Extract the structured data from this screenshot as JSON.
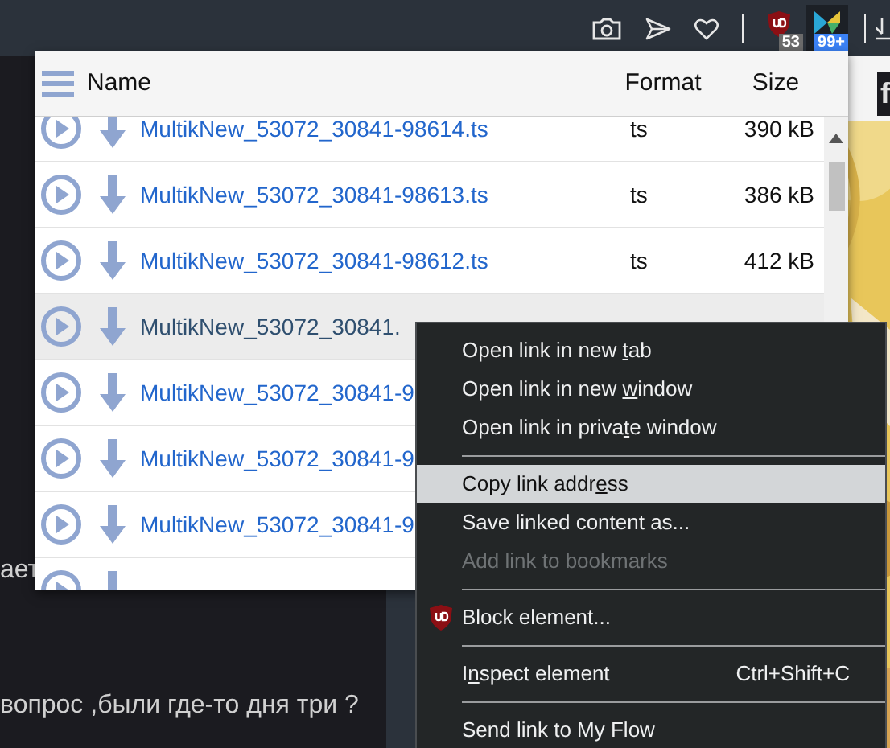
{
  "toolbar": {
    "badges": [
      {
        "kind": "ublock",
        "count": "53"
      },
      {
        "kind": "extension",
        "count": "99+"
      }
    ]
  },
  "page": {
    "texts": [
      "ает",
      "вопрос ,были где-то дня три ?"
    ],
    "side_letter": "f"
  },
  "panel": {
    "columns": [
      "Name",
      "Format",
      "Size"
    ],
    "rows": [
      {
        "name": "MultikNew_53072_30841-98614.ts",
        "format": "ts",
        "size": "390 kB",
        "hovered": false
      },
      {
        "name": "MultikNew_53072_30841-98613.ts",
        "format": "ts",
        "size": "386 kB",
        "hovered": false
      },
      {
        "name": "MultikNew_53072_30841-98612.ts",
        "format": "ts",
        "size": "412 kB",
        "hovered": false
      },
      {
        "name": "MultikNew_53072_30841.",
        "hovered": true
      },
      {
        "name": "MultikNew_53072_30841-9",
        "hovered": false
      },
      {
        "name": "MultikNew_53072_30841-9",
        "hovered": false
      },
      {
        "name": "MultikNew_53072_30841-9",
        "hovered": false
      },
      {
        "hovered": false
      }
    ]
  },
  "context_menu": {
    "items": [
      {
        "kind": "item",
        "label": [
          "Open link in new ",
          "t",
          "ab"
        ],
        "selected": false,
        "disabled": false
      },
      {
        "kind": "item",
        "label": [
          "Open link in new ",
          "w",
          "indow"
        ],
        "selected": false,
        "disabled": false
      },
      {
        "kind": "item",
        "label": [
          "Open link in priva",
          "t",
          "e window"
        ],
        "selected": false,
        "disabled": false
      },
      {
        "kind": "separator"
      },
      {
        "kind": "item",
        "label": [
          "Copy link addr",
          "e",
          "ss"
        ],
        "selected": true,
        "disabled": false
      },
      {
        "kind": "item",
        "label": [
          "Save linked content as..."
        ],
        "selected": false,
        "disabled": false
      },
      {
        "kind": "item",
        "label": [
          "Add link to bookmarks"
        ],
        "selected": false,
        "disabled": true
      },
      {
        "kind": "separator"
      },
      {
        "kind": "shield_item",
        "label": [
          "Block element..."
        ],
        "selected": false,
        "disabled": false
      },
      {
        "kind": "separator"
      },
      {
        "kind": "item",
        "label": [
          "I",
          "n",
          "spect element"
        ],
        "selected": false,
        "disabled": false,
        "shortcut": "Ctrl+Shift+C"
      },
      {
        "kind": "separator"
      },
      {
        "kind": "item",
        "label": [
          "Send link to My Flow"
        ],
        "selected": false,
        "disabled": false
      }
    ]
  }
}
